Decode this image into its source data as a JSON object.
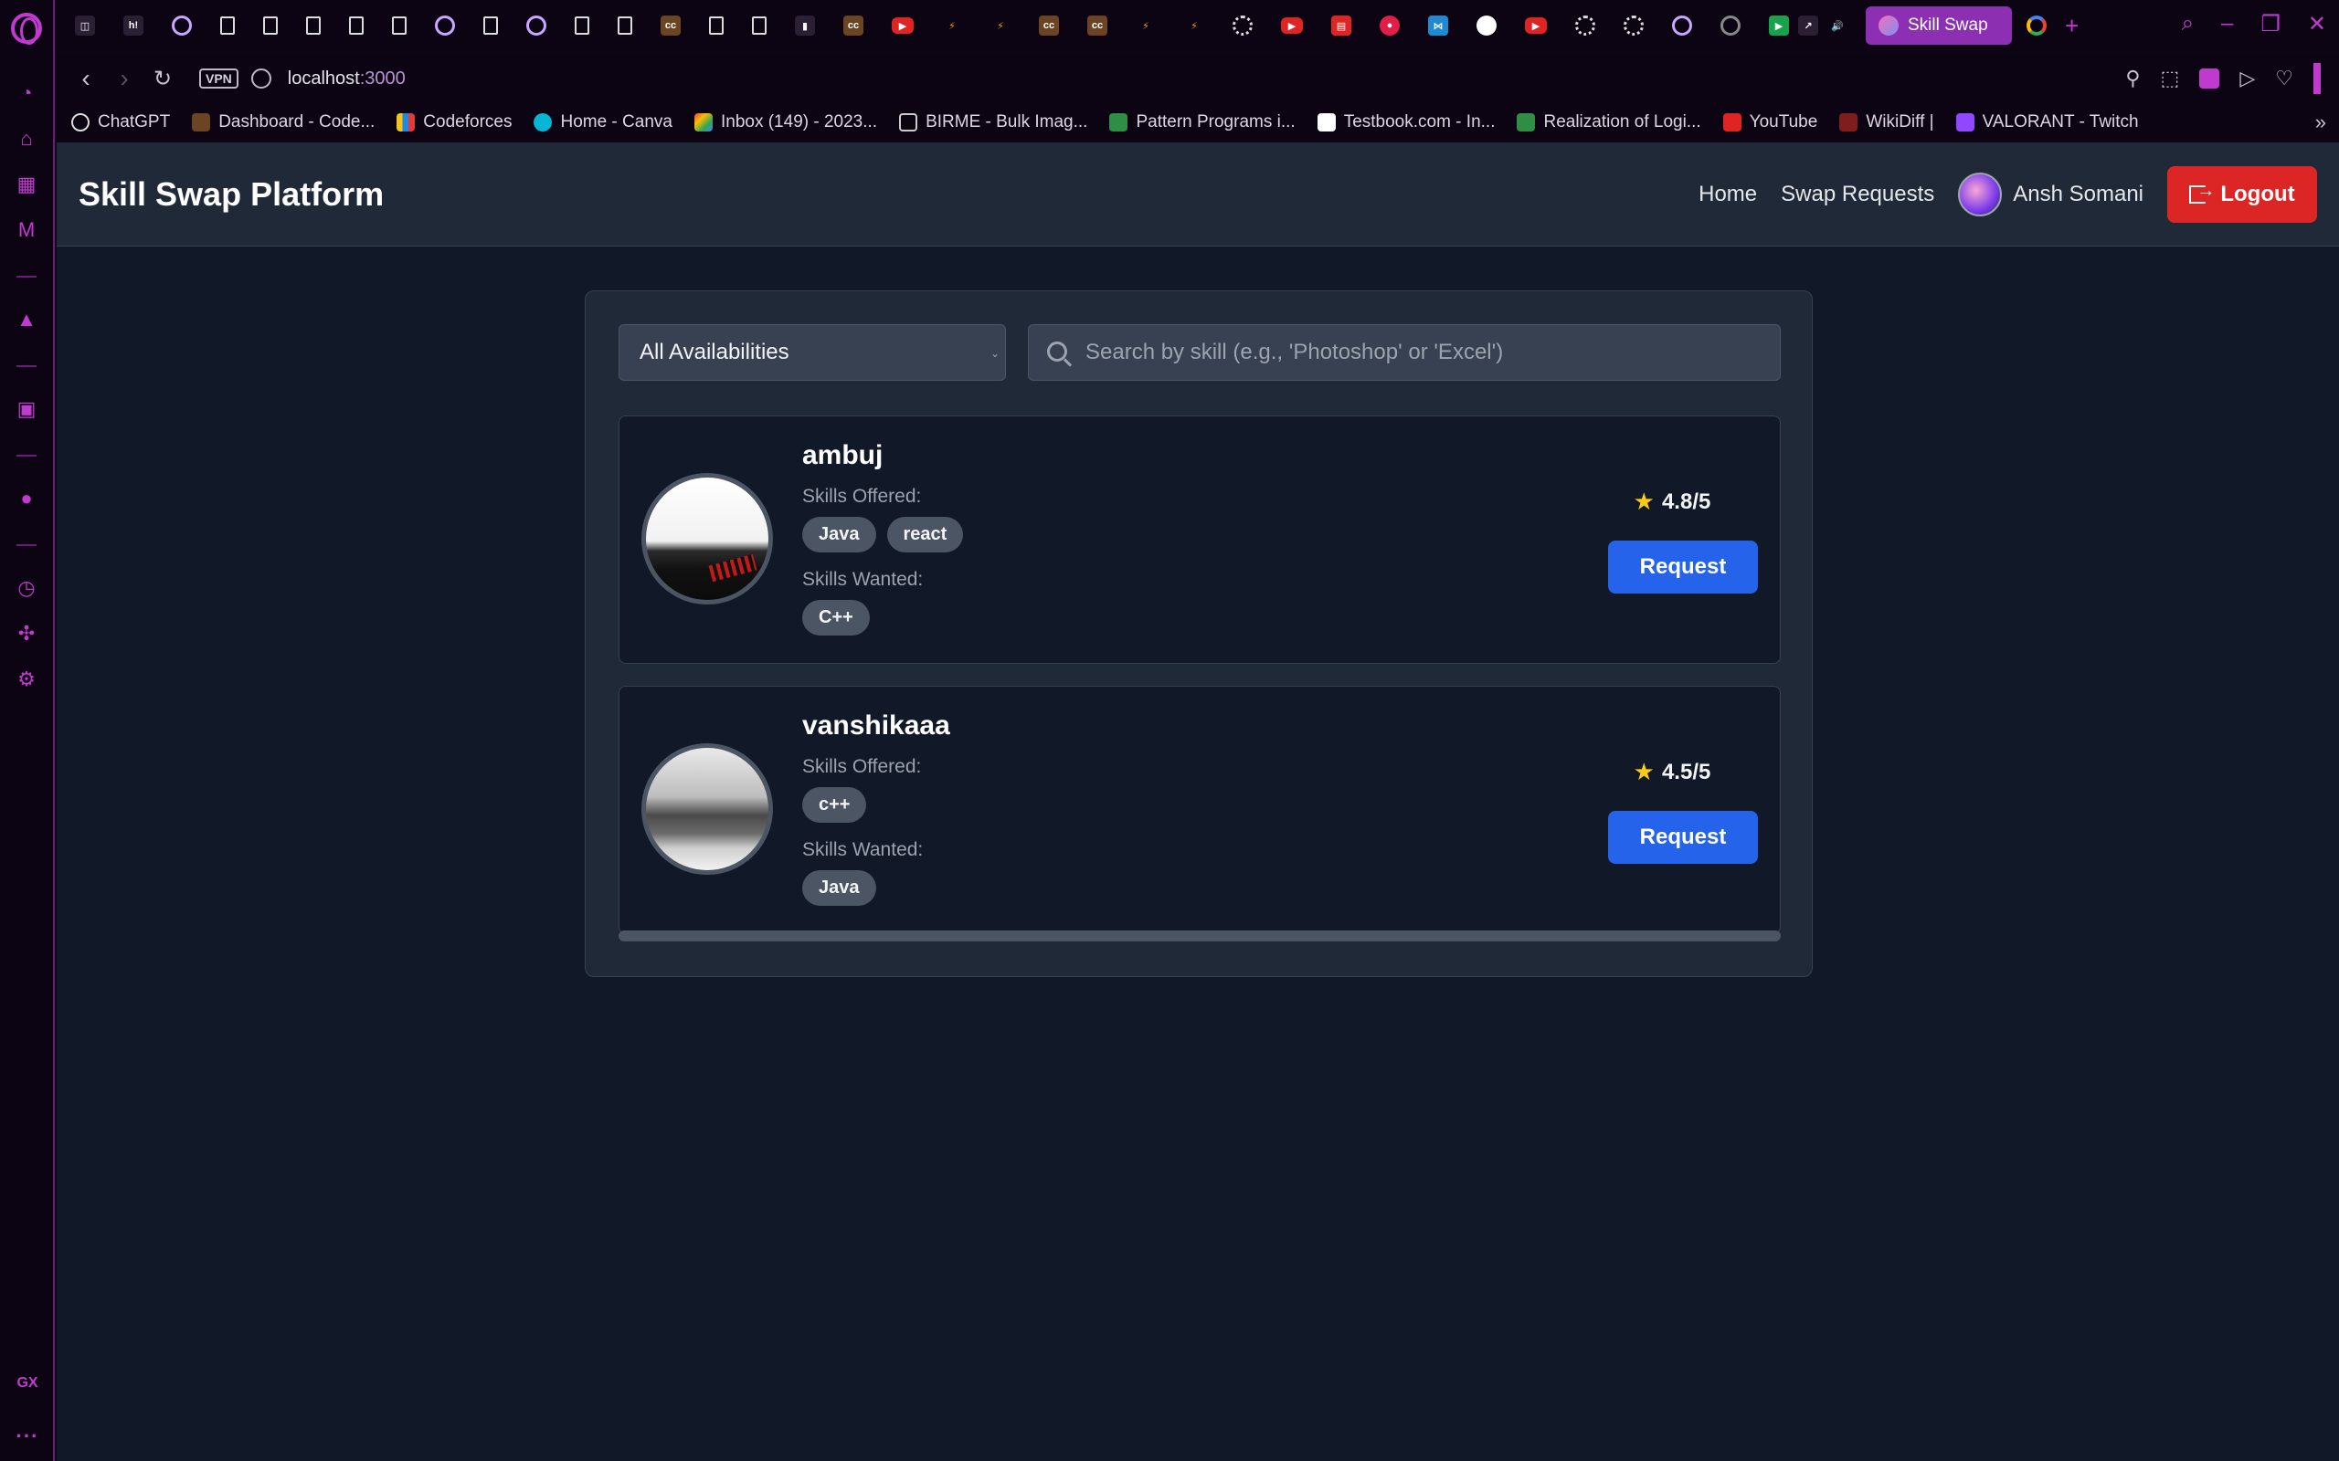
{
  "browser": {
    "active_tab": {
      "title": "Skill Swap"
    },
    "address": {
      "host": "localhost",
      "port": ":3000",
      "vpn_label": "VPN"
    },
    "bookmarks": [
      {
        "label": "ChatGPT"
      },
      {
        "label": "Dashboard - Code..."
      },
      {
        "label": "Codeforces"
      },
      {
        "label": "Home - Canva"
      },
      {
        "label": "Inbox (149) - 2023..."
      },
      {
        "label": "BIRME - Bulk Imag..."
      },
      {
        "label": "Pattern Programs i..."
      },
      {
        "label": "Testbook.com - In..."
      },
      {
        "label": "Realization of Logi..."
      },
      {
        "label": "YouTube"
      },
      {
        "label": "WikiDiff |"
      },
      {
        "label": "VALORANT - Twitch"
      }
    ],
    "sidebar_bottom_label": "GX"
  },
  "app": {
    "brand": "Skill Swap Platform",
    "nav": {
      "home": "Home",
      "swap_requests": "Swap Requests",
      "user_name": "Ansh Somani",
      "logout": "Logout"
    },
    "filters": {
      "availability_selected": "All Availabilities",
      "search_placeholder": "Search by skill (e.g., 'Photoshop' or 'Excel')"
    },
    "labels": {
      "skills_offered": "Skills Offered:",
      "skills_wanted": "Skills Wanted:",
      "request": "Request"
    },
    "users": [
      {
        "name": "ambuj",
        "skills_offered": [
          "Java",
          "react"
        ],
        "skills_wanted": [
          "C++"
        ],
        "rating": "4.8/5"
      },
      {
        "name": "vanshikaaa",
        "skills_offered": [
          "c++"
        ],
        "skills_wanted": [
          "Java"
        ],
        "rating": "4.5/5"
      }
    ]
  }
}
